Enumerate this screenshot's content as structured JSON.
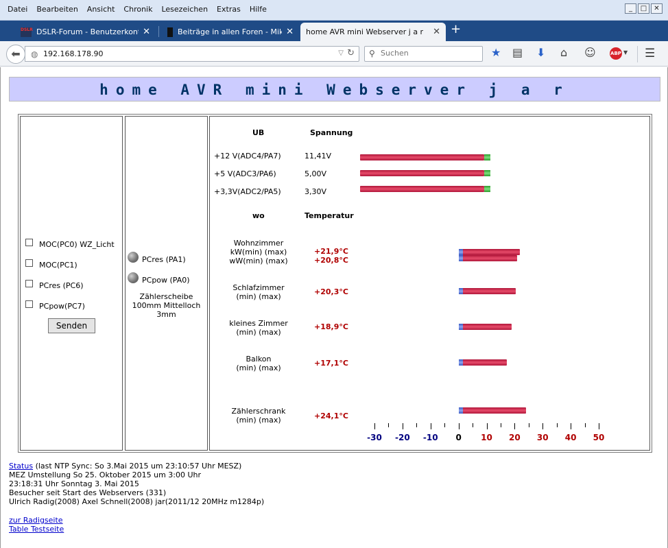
{
  "menubar": [
    "Datei",
    "Bearbeiten",
    "Ansicht",
    "Chronik",
    "Lesezeichen",
    "Extras",
    "Hilfe"
  ],
  "window_controls": [
    "_",
    "□",
    "✕"
  ],
  "tabs": [
    {
      "title": "DSLR-Forum - Benutzerkontro...",
      "favicon": "DSLR",
      "active": false
    },
    {
      "title": "Beiträge in allen Foren - Mikro...",
      "favicon": "",
      "active": false
    },
    {
      "title": "home AVR mini Webserver j a r",
      "favicon": "",
      "active": true
    }
  ],
  "tab_close": "✕",
  "new_tab": "+",
  "nav": {
    "url": "192.168.178.90",
    "search_placeholder": "Suchen",
    "icons": [
      "back-arrow-icon",
      "globe-icon",
      "reload-icon",
      "search-icon",
      "bookmark-star-icon",
      "reading-list-icon",
      "download-icon",
      "home-icon",
      "hello-icon",
      "adblock-icon",
      "menu-icon"
    ]
  },
  "page": {
    "banner_title": "home AVR mini Webserver j a r",
    "checkboxes": [
      "MOC(PC0) WZ_Licht",
      "MOC(PC1)",
      "PCres (PC6)",
      "PCpow(PC7)"
    ],
    "send_button": "Senden",
    "leds": [
      "PCres (PA1)",
      "PCpow (PA0)"
    ],
    "zaehler": [
      "Zählerscheibe",
      "100mm Mittelloch",
      "3mm"
    ],
    "voltage_header": {
      "col1": "UB",
      "col2": "Spannung"
    },
    "voltages": [
      {
        "label": "+12 V(ADC4/PA7)",
        "value": "11,41V",
        "level": 11.41
      },
      {
        "label": "+5 V(ADC3/PA6)",
        "value": "5,00V",
        "level": 5.0
      },
      {
        "label": "+3,3V(ADC2/PA5)",
        "value": "3,30V",
        "level": 3.3
      }
    ],
    "temp_header": {
      "col1": "wo",
      "col2": "Temperatur"
    },
    "temperatures": [
      {
        "lines": [
          "Wohnzimmer",
          "kW(min) (max)",
          "wW(min) (max)"
        ],
        "values": [
          "+21,9°C",
          "+20,8°C"
        ],
        "levels": [
          21.9,
          20.8
        ]
      },
      {
        "lines": [
          "Schlafzimmer",
          "(min) (max)"
        ],
        "values": [
          "+20,3°C"
        ],
        "levels": [
          20.3
        ]
      },
      {
        "lines": [
          "kleines Zimmer",
          "(min) (max)"
        ],
        "values": [
          "+18,9°C"
        ],
        "levels": [
          18.9
        ]
      },
      {
        "lines": [
          "Balkon",
          "(min) (max)"
        ],
        "values": [
          "+17,1°C"
        ],
        "levels": [
          17.1
        ]
      },
      {
        "lines": [
          "Zählerschrank",
          "(min) (max)"
        ],
        "values": [
          "+24,1°C"
        ],
        "levels": [
          24.1
        ]
      }
    ],
    "axis_labels": [
      "-30",
      "-20",
      "-10",
      "0",
      "10",
      "20",
      "30",
      "40",
      "50"
    ],
    "axis_range": [
      -30,
      50
    ],
    "colors": {
      "banner_bg": "#ccccff",
      "banner_text": "#003366",
      "temp_value": "#b00000",
      "axis_negative": "#000080",
      "axis_positive": "#b00000"
    },
    "footer": {
      "status_link": "Status",
      "status_text": "(last NTP Sync: So 3.Mai 2015 um 23:10:57 Uhr MESZ)",
      "line2": "MEZ Umstellung So 25. Oktober 2015 um 3:00 Uhr",
      "line3": "23:18:31 Uhr Sonntag 3. Mai 2015",
      "line4": "Besucher seit Start des Webservers (331)",
      "line5": "Ulrich Radig(2008) Axel Schnell(2008) jar(2011/12 20MHz m1284p)",
      "link1": "zur Radigseite",
      "link2": "Table Testseite"
    }
  }
}
